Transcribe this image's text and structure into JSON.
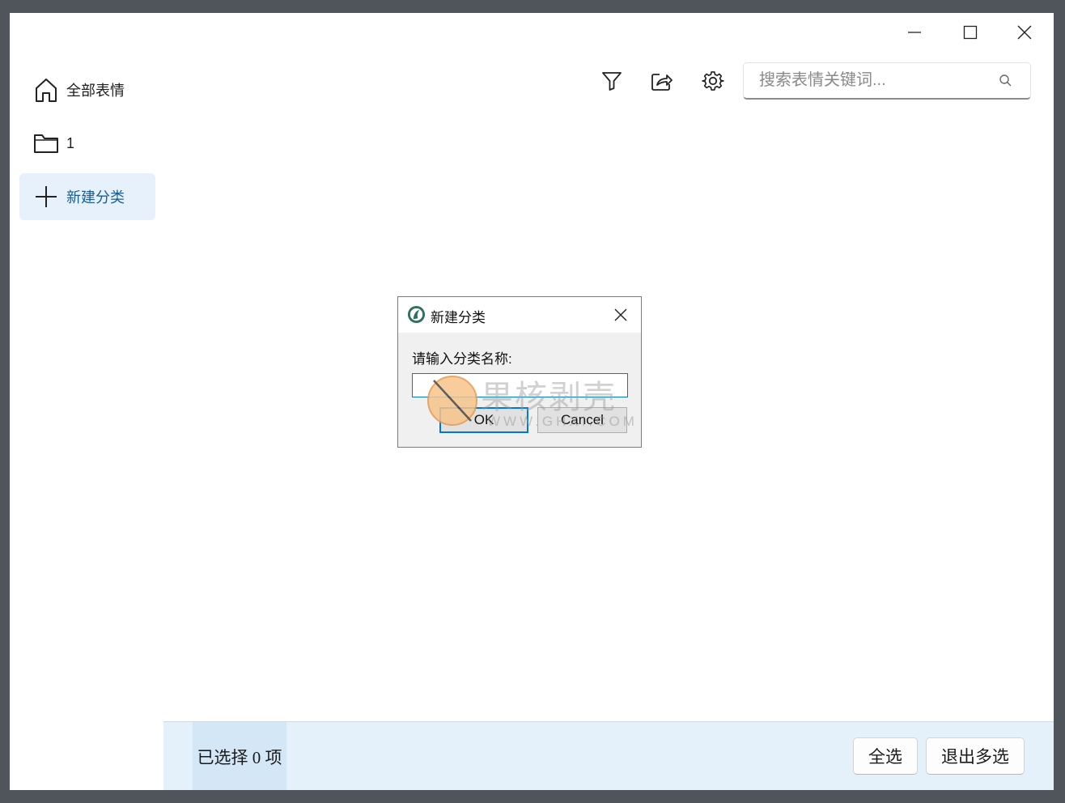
{
  "window": {
    "controls": {
      "minimize_icon": "minimize-icon",
      "maximize_icon": "maximize-icon",
      "close_icon": "close-icon"
    }
  },
  "sidebar": {
    "items": [
      {
        "label": "全部表情",
        "icon": "home-icon"
      },
      {
        "label": "1",
        "icon": "folder-icon"
      },
      {
        "label": "新建分类",
        "icon": "plus-icon",
        "active": true
      }
    ]
  },
  "toolbar": {
    "filter_icon": "filter-icon",
    "share_icon": "share-icon",
    "settings_icon": "gear-icon",
    "search": {
      "placeholder": "搜索表情关键词...",
      "value": ""
    }
  },
  "dialog": {
    "title": "新建分类",
    "prompt": "请输入分类名称:",
    "input_value": "",
    "ok_label": "OK",
    "cancel_label": "Cancel"
  },
  "bottombar": {
    "selection_count": "已选择 0 项",
    "select_all_label": "全选",
    "exit_multi_label": "退出多选"
  },
  "watermark": {
    "text": "果核剥壳",
    "url": "WWW.GHXI.COM"
  },
  "colors": {
    "accent": "#0078d7",
    "nav_active_bg": "#e6f1fb",
    "bottombar_bg": "#e4f0fa",
    "frame": "#4f555b"
  }
}
